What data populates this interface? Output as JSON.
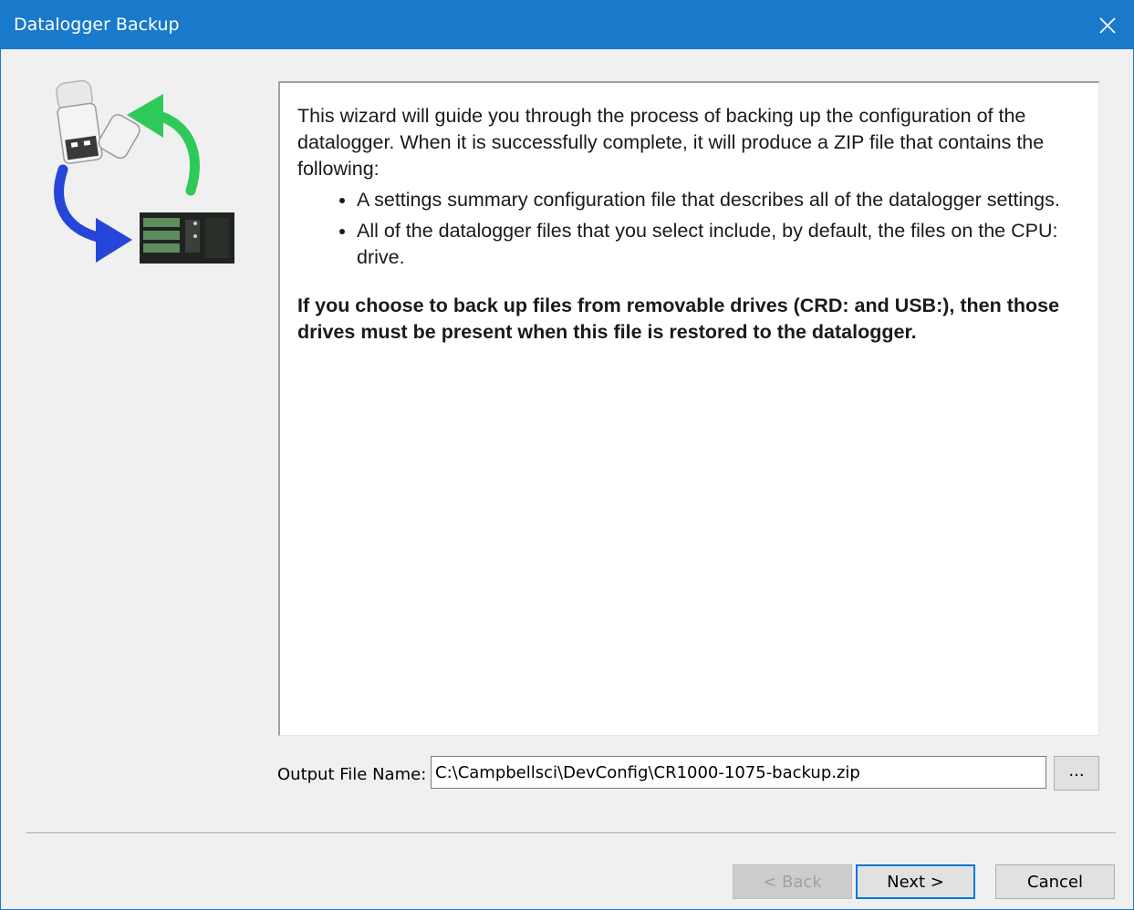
{
  "window": {
    "title": "Datalogger Backup",
    "titlebar_color": "#1979ca",
    "close_icon": "close-icon"
  },
  "wizard_icon": "datalogger-backup-icon",
  "info": {
    "intro": "This wizard will guide you through the process of backing up the configuration of the datalogger. When it is successfully complete, it will produce a ZIP file that contains the following:",
    "bullets": [
      "A settings summary configuration file that describes all of the datalogger settings.",
      "All of the datalogger files that you select include, by default, the files on the CPU: drive."
    ],
    "note": "If you choose to back up files from removable drives (CRD: and USB:), then those drives must be present when this file is restored to the datalogger."
  },
  "output": {
    "label": "Output File Name:",
    "value": "C:\\Campbellsci\\DevConfig\\CR1000-1075-backup.zip",
    "browse_label": "..."
  },
  "buttons": {
    "back": "< Back",
    "next": "Next >",
    "cancel": "Cancel"
  }
}
